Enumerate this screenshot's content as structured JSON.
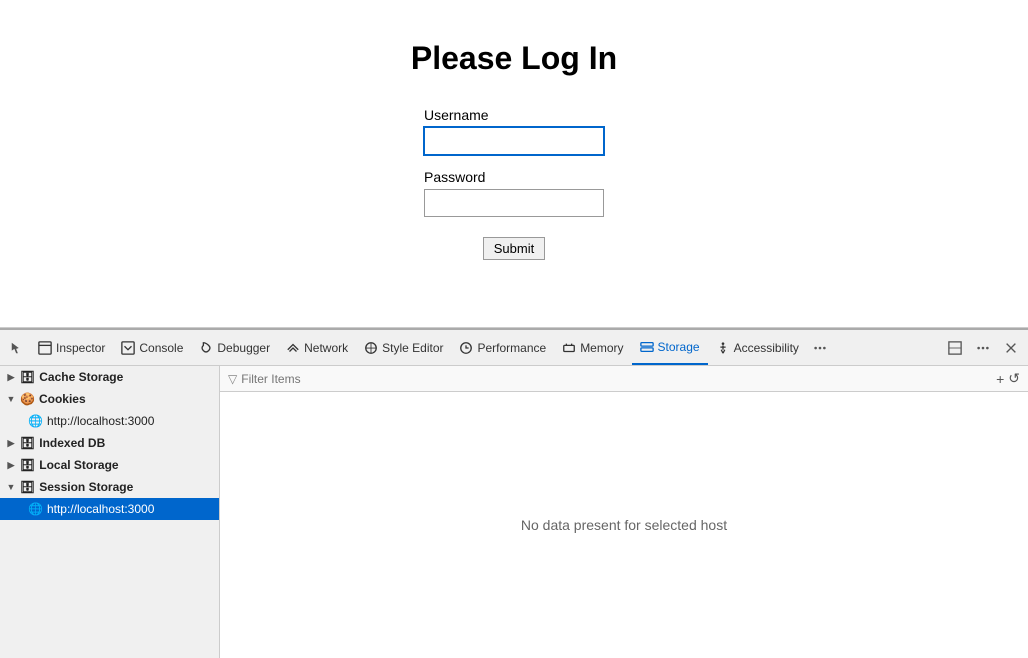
{
  "page": {
    "title": "Please Log In",
    "username_label": "Username",
    "password_label": "Password",
    "submit_label": "Submit"
  },
  "devtools": {
    "tabs": [
      {
        "id": "inspector",
        "label": "Inspector"
      },
      {
        "id": "console",
        "label": "Console"
      },
      {
        "id": "debugger",
        "label": "Debugger"
      },
      {
        "id": "network",
        "label": "Network"
      },
      {
        "id": "style-editor",
        "label": "Style Editor"
      },
      {
        "id": "performance",
        "label": "Performance"
      },
      {
        "id": "memory",
        "label": "Memory"
      },
      {
        "id": "storage",
        "label": "Storage"
      },
      {
        "id": "accessibility",
        "label": "Accessibility"
      }
    ],
    "sidebar": {
      "groups": [
        {
          "id": "cache-storage",
          "label": "Cache Storage",
          "expanded": false,
          "children": []
        },
        {
          "id": "cookies",
          "label": "Cookies",
          "expanded": true,
          "children": [
            {
              "id": "cookies-localhost",
              "label": "http://localhost:3000"
            }
          ]
        },
        {
          "id": "indexed-db",
          "label": "Indexed DB",
          "expanded": false,
          "children": []
        },
        {
          "id": "local-storage",
          "label": "Local Storage",
          "expanded": false,
          "children": []
        },
        {
          "id": "session-storage",
          "label": "Session Storage",
          "expanded": true,
          "children": [
            {
              "id": "session-localhost",
              "label": "http://localhost:3000",
              "active": true
            }
          ]
        }
      ]
    },
    "filter_placeholder": "Filter Items",
    "empty_message": "No data present for selected host"
  }
}
